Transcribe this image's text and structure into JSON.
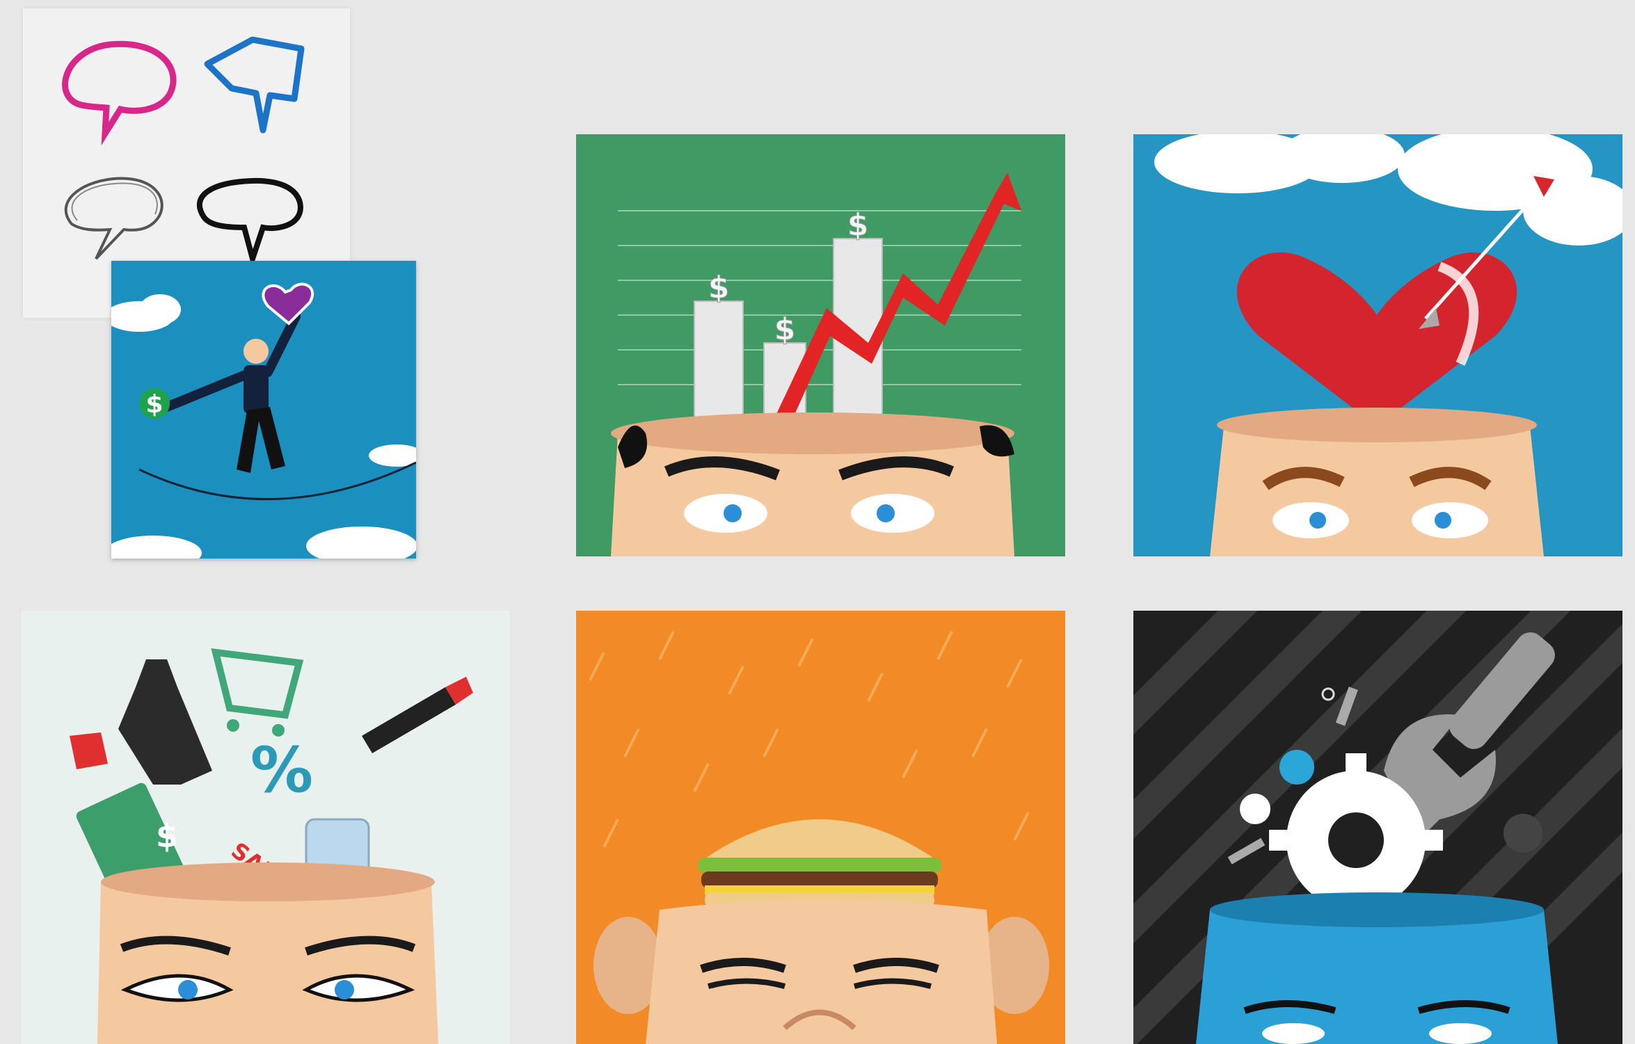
{
  "gallery": {
    "panels": [
      {
        "id": "speech-bubbles",
        "background": "#f1f1f1"
      },
      {
        "id": "tightrope",
        "background": "#1b8fbe"
      },
      {
        "id": "money-mind",
        "background": "#3f9a64"
      },
      {
        "id": "love-mind",
        "background": "#2596c3"
      },
      {
        "id": "shopping-mind",
        "background": "#e9f1ee"
      },
      {
        "id": "burger-mind",
        "background": "#f28a25"
      },
      {
        "id": "gear-mind",
        "background": "#202020"
      }
    ]
  },
  "icons": {
    "dollar_sign": "$",
    "percent_sign": "%",
    "sale_text": "SALE"
  },
  "colors": {
    "skin": "#f4c9a0",
    "skin_shadow": "#e2a982",
    "red": "#d9262a",
    "pink": "#d8278b",
    "blue_bubble": "#1d73c8",
    "eye_blue": "#2a8fd6"
  }
}
